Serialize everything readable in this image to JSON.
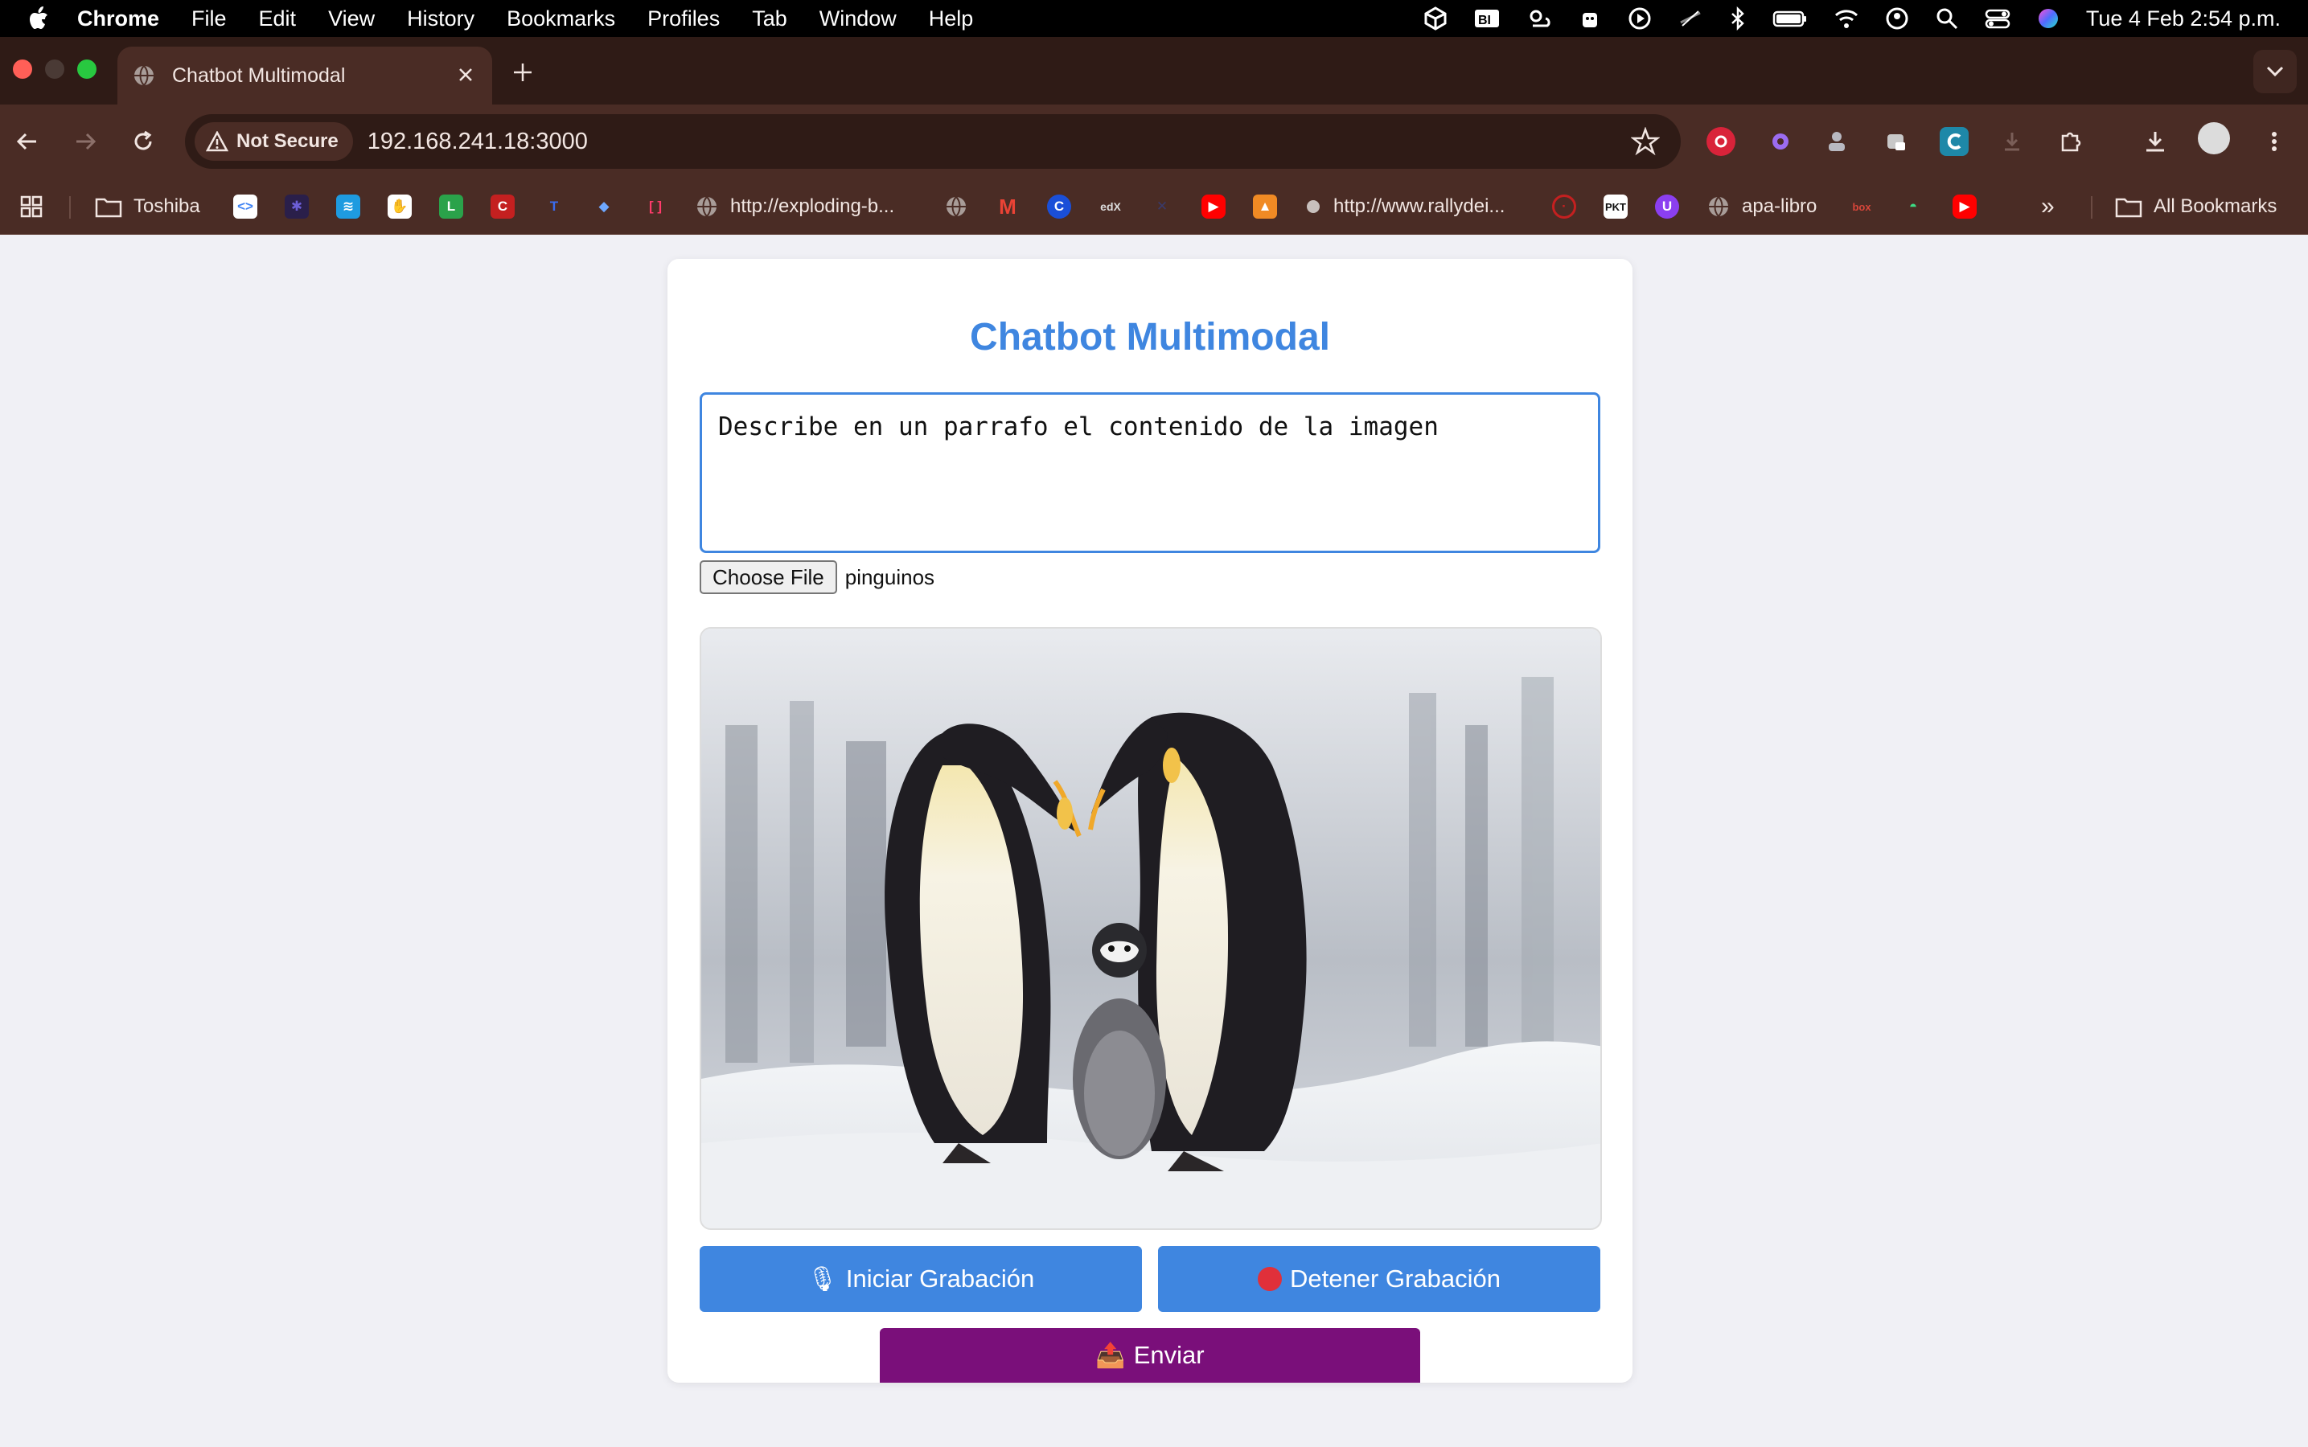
{
  "menubar": {
    "app_name": "Chrome",
    "items": [
      "File",
      "Edit",
      "View",
      "History",
      "Bookmarks",
      "Profiles",
      "Tab",
      "Window",
      "Help"
    ],
    "clock": "Tue 4 Feb  2:54 p.m."
  },
  "browser": {
    "tab_title": "Chatbot Multimodal",
    "security_label": "Not Secure",
    "url": "192.168.241.18:3000",
    "bookmarks": [
      {
        "label": "Toshiba",
        "icon": "folder-icon"
      },
      {
        "label": "http://exploding-b...",
        "icon": "globe-icon"
      },
      {
        "label": "http://www.rallydei...",
        "icon": "globe-icon"
      },
      {
        "label": "apa-libro",
        "icon": "globe-icon"
      },
      {
        "label": "All Bookmarks",
        "icon": "folder-icon"
      }
    ]
  },
  "page": {
    "title": "Chatbot Multimodal",
    "prompt_text": "Describe en un parrafo el contenido de la imagen",
    "file_button": "Choose File",
    "file_name": "pinguinos",
    "image_alt": "penguins",
    "start_button": "Iniciar Grabación",
    "stop_button": "Detener Grabación",
    "send_button": "Enviar"
  },
  "colors": {
    "accent": "#3f86e0",
    "send": "#7a0f7a",
    "tab_strip": "#2f1b16",
    "toolbar": "#4a2c25"
  }
}
